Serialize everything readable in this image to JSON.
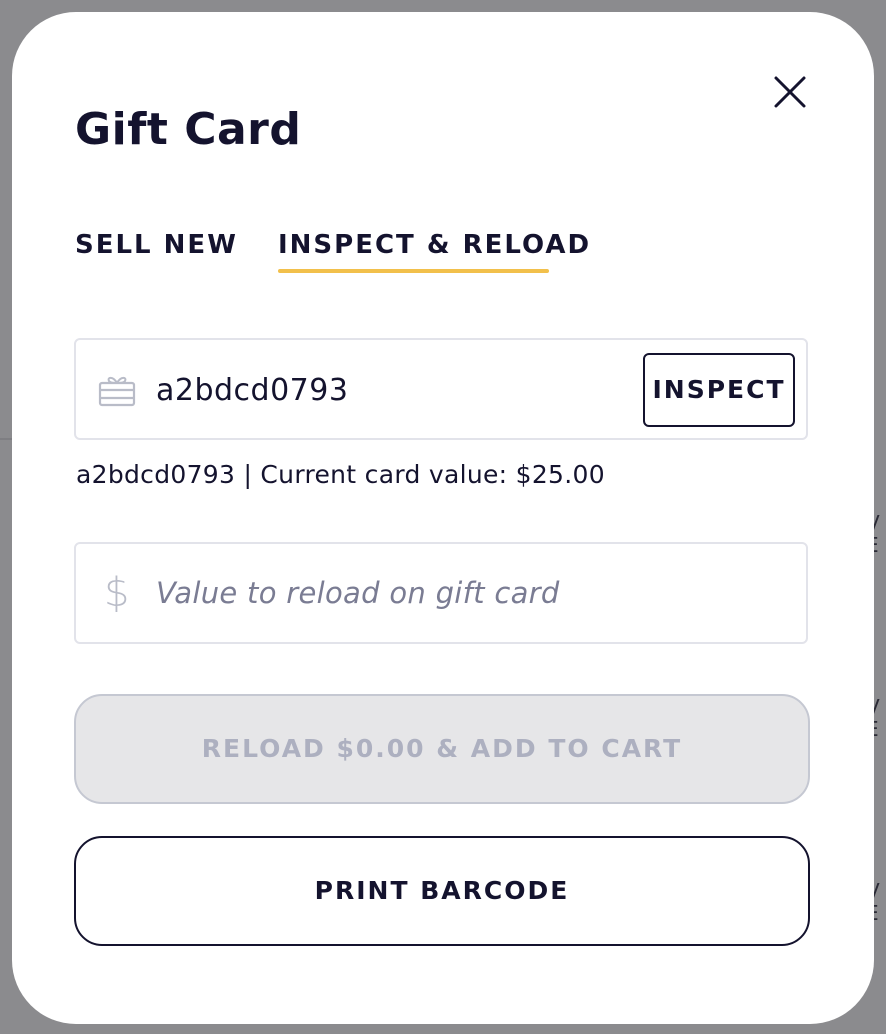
{
  "modal": {
    "title": "Gift Card",
    "close_icon": "close-icon"
  },
  "tabs": [
    {
      "label": "SELL NEW",
      "active": false
    },
    {
      "label": "INSPECT & RELOAD",
      "active": true
    }
  ],
  "colors": {
    "active_tab_underline": "#f2c04b",
    "text": "#14132e",
    "disabled_button_bg": "#e6e6e8",
    "disabled_button_text": "#adb0c0"
  },
  "card_field": {
    "icon": "gift-card-icon",
    "value": "a2bdcd0793",
    "button_label": "INSPECT"
  },
  "card_info": "a2bdcd0793 | Current card value: $25.00",
  "reload_field": {
    "icon": "dollar-icon",
    "icon_glyph": "$",
    "placeholder": "Value to reload on gift card",
    "value": ""
  },
  "buttons": {
    "reload_label": "RELOAD $0.00 & ADD TO CART",
    "reload_disabled": true,
    "print_label": "PRINT BARCODE"
  }
}
